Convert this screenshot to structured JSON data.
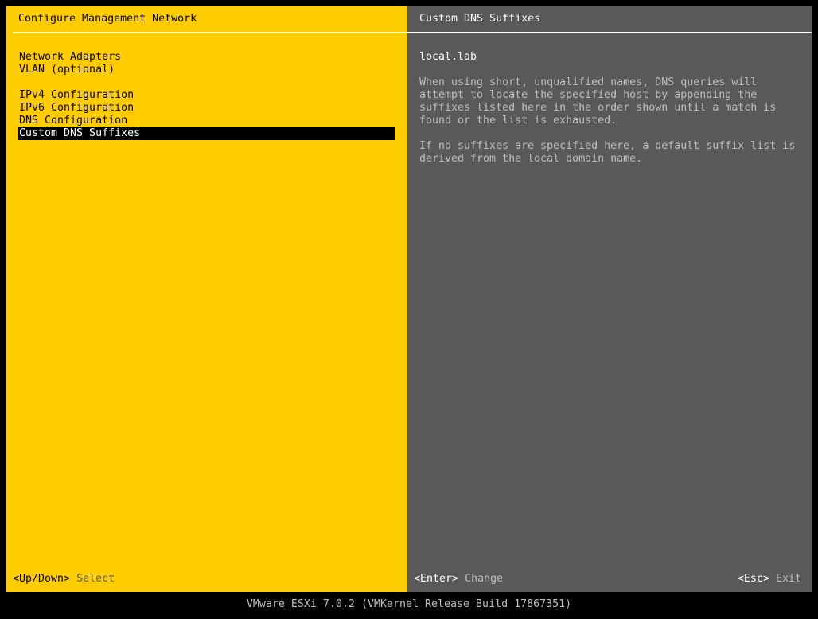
{
  "colors": {
    "left_pane_bg": "#ffcc00",
    "right_pane_bg": "#595959",
    "screen_bg": "#000000",
    "selection_bg": "#000000"
  },
  "left_pane": {
    "title": "Configure Management Network",
    "menu": {
      "network_adapters": "Network Adapters",
      "vlan": "VLAN (optional)",
      "ipv4": "IPv4 Configuration",
      "ipv6": "IPv6 Configuration",
      "dns": "DNS Configuration",
      "custom_dns": "Custom DNS Suffixes"
    },
    "selected_item": "Custom DNS Suffixes",
    "footer": {
      "key": "<Up/Down>",
      "action": "Select"
    }
  },
  "right_pane": {
    "title": "Custom DNS Suffixes",
    "value": "local.lab",
    "description": [
      "When using short, unqualified names, DNS queries will\nattempt to locate the specified host by appending the\nsuffixes listed here in the order shown until a match is\nfound or the list is exhausted.",
      "If no suffixes are specified here, a default suffix list is\nderived from the local domain name."
    ],
    "footer": {
      "enter_key": "<Enter>",
      "enter_action": "Change",
      "esc_key": "<Esc>",
      "esc_action": "Exit"
    }
  },
  "status_bar": {
    "text": "VMware ESXi 7.0.2 (VMKernel Release Build 17867351)"
  }
}
